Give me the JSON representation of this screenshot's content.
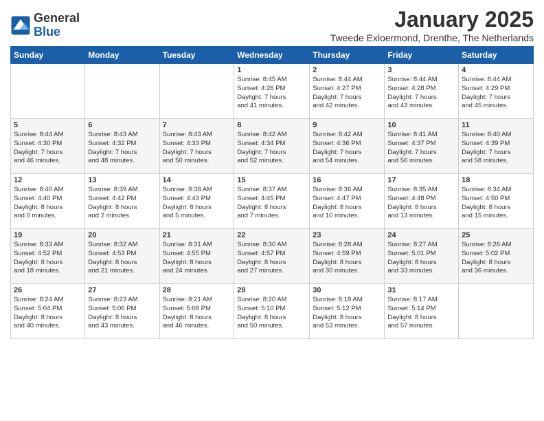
{
  "logo": {
    "line1": "General",
    "line2": "Blue"
  },
  "title": "January 2025",
  "subtitle": "Tweede Exloermond, Drenthe, The Netherlands",
  "weekdays": [
    "Sunday",
    "Monday",
    "Tuesday",
    "Wednesday",
    "Thursday",
    "Friday",
    "Saturday"
  ],
  "weeks": [
    [
      {
        "day": "",
        "info": ""
      },
      {
        "day": "",
        "info": ""
      },
      {
        "day": "",
        "info": ""
      },
      {
        "day": "1",
        "info": "Sunrise: 8:45 AM\nSunset: 4:26 PM\nDaylight: 7 hours\nand 41 minutes."
      },
      {
        "day": "2",
        "info": "Sunrise: 8:44 AM\nSunset: 4:27 PM\nDaylight: 7 hours\nand 42 minutes."
      },
      {
        "day": "3",
        "info": "Sunrise: 8:44 AM\nSunset: 4:28 PM\nDaylight: 7 hours\nand 43 minutes."
      },
      {
        "day": "4",
        "info": "Sunrise: 8:44 AM\nSunset: 4:29 PM\nDaylight: 7 hours\nand 45 minutes."
      }
    ],
    [
      {
        "day": "5",
        "info": "Sunrise: 8:44 AM\nSunset: 4:30 PM\nDaylight: 7 hours\nand 46 minutes."
      },
      {
        "day": "6",
        "info": "Sunrise: 8:43 AM\nSunset: 4:32 PM\nDaylight: 7 hours\nand 48 minutes."
      },
      {
        "day": "7",
        "info": "Sunrise: 8:43 AM\nSunset: 4:33 PM\nDaylight: 7 hours\nand 50 minutes."
      },
      {
        "day": "8",
        "info": "Sunrise: 8:42 AM\nSunset: 4:34 PM\nDaylight: 7 hours\nand 52 minutes."
      },
      {
        "day": "9",
        "info": "Sunrise: 8:42 AM\nSunset: 4:36 PM\nDaylight: 7 hours\nand 54 minutes."
      },
      {
        "day": "10",
        "info": "Sunrise: 8:41 AM\nSunset: 4:37 PM\nDaylight: 7 hours\nand 56 minutes."
      },
      {
        "day": "11",
        "info": "Sunrise: 8:40 AM\nSunset: 4:39 PM\nDaylight: 7 hours\nand 58 minutes."
      }
    ],
    [
      {
        "day": "12",
        "info": "Sunrise: 8:40 AM\nSunset: 4:40 PM\nDaylight: 8 hours\nand 0 minutes."
      },
      {
        "day": "13",
        "info": "Sunrise: 8:39 AM\nSunset: 4:42 PM\nDaylight: 8 hours\nand 2 minutes."
      },
      {
        "day": "14",
        "info": "Sunrise: 8:38 AM\nSunset: 4:43 PM\nDaylight: 8 hours\nand 5 minutes."
      },
      {
        "day": "15",
        "info": "Sunrise: 8:37 AM\nSunset: 4:45 PM\nDaylight: 8 hours\nand 7 minutes."
      },
      {
        "day": "16",
        "info": "Sunrise: 8:36 AM\nSunset: 4:47 PM\nDaylight: 8 hours\nand 10 minutes."
      },
      {
        "day": "17",
        "info": "Sunrise: 8:35 AM\nSunset: 4:48 PM\nDaylight: 8 hours\nand 13 minutes."
      },
      {
        "day": "18",
        "info": "Sunrise: 8:34 AM\nSunset: 4:50 PM\nDaylight: 8 hours\nand 15 minutes."
      }
    ],
    [
      {
        "day": "19",
        "info": "Sunrise: 8:33 AM\nSunset: 4:52 PM\nDaylight: 8 hours\nand 18 minutes."
      },
      {
        "day": "20",
        "info": "Sunrise: 8:32 AM\nSunset: 4:53 PM\nDaylight: 8 hours\nand 21 minutes."
      },
      {
        "day": "21",
        "info": "Sunrise: 8:31 AM\nSunset: 4:55 PM\nDaylight: 8 hours\nand 24 minutes."
      },
      {
        "day": "22",
        "info": "Sunrise: 8:30 AM\nSunset: 4:57 PM\nDaylight: 8 hours\nand 27 minutes."
      },
      {
        "day": "23",
        "info": "Sunrise: 8:28 AM\nSunset: 4:59 PM\nDaylight: 8 hours\nand 30 minutes."
      },
      {
        "day": "24",
        "info": "Sunrise: 8:27 AM\nSunset: 5:01 PM\nDaylight: 8 hours\nand 33 minutes."
      },
      {
        "day": "25",
        "info": "Sunrise: 8:26 AM\nSunset: 5:02 PM\nDaylight: 8 hours\nand 36 minutes."
      }
    ],
    [
      {
        "day": "26",
        "info": "Sunrise: 8:24 AM\nSunset: 5:04 PM\nDaylight: 8 hours\nand 40 minutes."
      },
      {
        "day": "27",
        "info": "Sunrise: 8:23 AM\nSunset: 5:06 PM\nDaylight: 8 hours\nand 43 minutes."
      },
      {
        "day": "28",
        "info": "Sunrise: 8:21 AM\nSunset: 5:08 PM\nDaylight: 8 hours\nand 46 minutes."
      },
      {
        "day": "29",
        "info": "Sunrise: 8:20 AM\nSunset: 5:10 PM\nDaylight: 8 hours\nand 50 minutes."
      },
      {
        "day": "30",
        "info": "Sunrise: 8:18 AM\nSunset: 5:12 PM\nDaylight: 8 hours\nand 53 minutes."
      },
      {
        "day": "31",
        "info": "Sunrise: 8:17 AM\nSunset: 5:14 PM\nDaylight: 8 hours\nand 57 minutes."
      },
      {
        "day": "",
        "info": ""
      }
    ]
  ]
}
